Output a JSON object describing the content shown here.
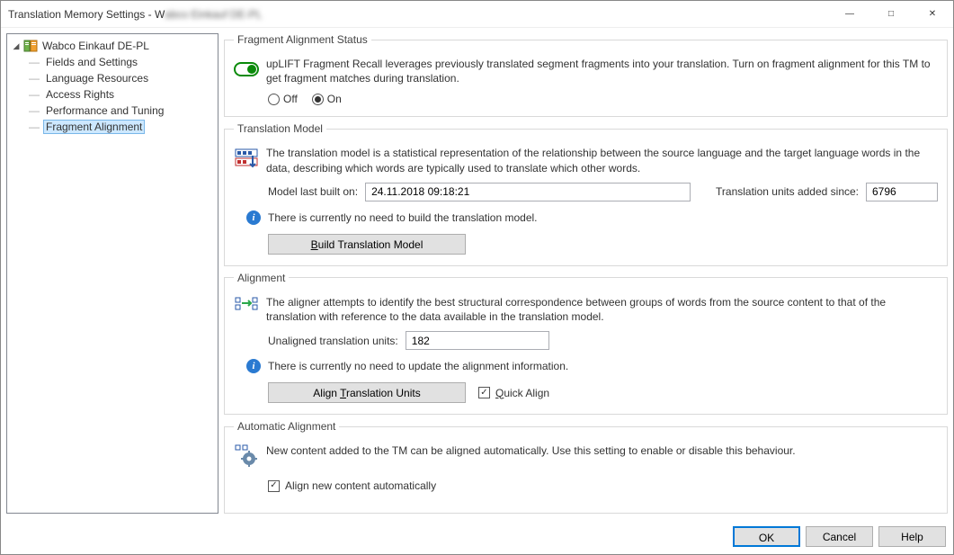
{
  "window": {
    "title_prefix": "Translation Memory Settings - W",
    "title_blur": "abco Einkauf DE-PL"
  },
  "tree": {
    "root": "Wabco Einkauf DE-PL",
    "items": [
      "Fields and Settings",
      "Language Resources",
      "Access Rights",
      "Performance and Tuning",
      "Fragment Alignment"
    ],
    "selected_index": 4
  },
  "status_section": {
    "legend": "Fragment Alignment Status",
    "description": "upLIFT Fragment Recall leverages previously translated segment fragments into your translation. Turn on fragment alignment for this TM to get fragment matches during translation.",
    "off_label": "Off",
    "on_label": "On",
    "on": true
  },
  "model_section": {
    "legend": "Translation Model",
    "description": "The translation model is a statistical representation of the relationship between the source language and the target language words in the data, describing which words are typically used to translate which other words.",
    "last_built_label": "Model last built on:",
    "last_built_value": "24.11.2018 09:18:21",
    "units_label": "Translation units added since:",
    "units_value": "6796",
    "info": "There is currently no need to build the translation model.",
    "button": "Build Translation Model"
  },
  "alignment_section": {
    "legend": "Alignment",
    "description": "The aligner attempts to identify the best structural correspondence between groups of words from the source content to that of the translation with reference to the data available in the translation model.",
    "unaligned_label": "Unaligned translation units:",
    "unaligned_value": "182",
    "info": "There is currently no need to update the alignment information.",
    "button": "Align Translation Units",
    "quick_align": "Quick Align",
    "quick_align_checked": true
  },
  "auto_section": {
    "legend": "Automatic Alignment",
    "description": "New content added to the TM can be aligned automatically. Use this setting to enable or disable this behaviour.",
    "checkbox": "Align new content automatically",
    "checked": true
  },
  "footer": {
    "ok": "OK",
    "cancel": "Cancel",
    "help": "Help"
  }
}
